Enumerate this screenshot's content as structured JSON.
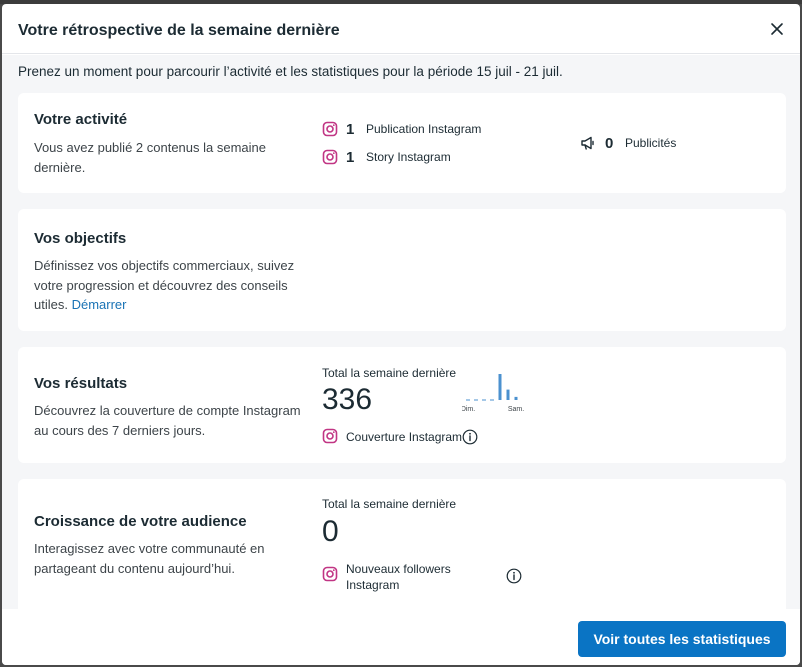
{
  "modal": {
    "title": "Votre rétrospective de la semaine dernière",
    "subtitle": "Prenez un moment pour parcourir l’activité et les statistiques pour la période 15 juil - 21 juil."
  },
  "activity": {
    "title": "Votre activité",
    "description": "Vous avez publié 2 contenus la semaine dernière.",
    "items": [
      {
        "count": "1",
        "label": "Publication Instagram",
        "icon": "instagram-icon"
      },
      {
        "count": "1",
        "label": "Story Instagram",
        "icon": "instagram-icon"
      }
    ],
    "ads": {
      "count": "0",
      "label": "Publicités",
      "icon": "megaphone-icon"
    }
  },
  "goals": {
    "title": "Vos objectifs",
    "description": "Définissez vos objectifs commerciaux, suivez votre progression et découvrez des conseils utiles.",
    "link": "Démarrer"
  },
  "results": {
    "title": "Vos résultats",
    "description": "Découvrez la couverture de compte Instagram au cours des 7 derniers jours.",
    "total_label": "Total la semaine dernière",
    "value": "336",
    "metric": "Couverture Instagram",
    "chart_data": {
      "type": "bar",
      "categories": [
        "Dim.",
        "",
        "",
        "",
        "",
        "",
        "Sam."
      ],
      "values": [
        0,
        0,
        0,
        0,
        1,
        0.4,
        0.12
      ],
      "tick_labels": [
        "Dim.",
        "Sam."
      ]
    }
  },
  "audience": {
    "title": "Croissance de votre audience",
    "description": "Interagissez avec votre communauté en partageant du contenu aujourd’hui.",
    "total_label": "Total la semaine dernière",
    "value": "0",
    "metric": "Nouveaux followers Instagram"
  },
  "footer": {
    "button_label": "Voir toutes les statistiques"
  },
  "colors": {
    "primary": "#0a74c4",
    "instagram": "#c13584",
    "chart_bar": "#4b91cf",
    "link": "#1a73b5"
  }
}
